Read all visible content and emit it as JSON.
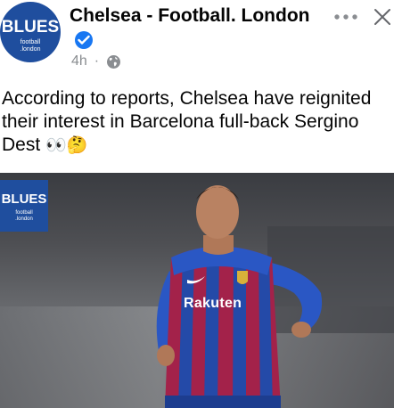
{
  "post": {
    "page_name": "Chelsea - Football. London",
    "timestamp": "4h",
    "separator": "·",
    "text": "According to reports, Chelsea have reignited their interest in Barcelona full-back Sergino Dest",
    "emojis": "👀🤔"
  },
  "avatar": {
    "brand": "BLUES",
    "sub_line1": "football",
    "sub_line2": ".london"
  },
  "photo": {
    "logo_brand": "BLUES",
    "logo_sub1": "football",
    "logo_sub2": ".london",
    "sponsor": "Rakuten"
  },
  "colors": {
    "brand_blue": "#1f4e9e",
    "verified_blue": "#1877f2",
    "meta_gray": "#8a8d91"
  },
  "icons": [
    "verified-badge-icon",
    "globe-icon",
    "more-options-icon",
    "close-icon"
  ]
}
